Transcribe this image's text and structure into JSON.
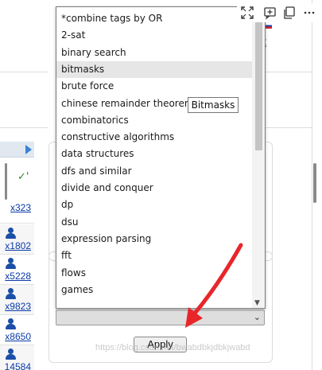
{
  "background": {
    "right_link": "t",
    "left_handles": [
      "x323",
      "x1802",
      "x5228",
      "x9823",
      "x8650",
      "14584"
    ]
  },
  "dropdown": {
    "items": [
      {
        "label": "*combine tags by OR",
        "highlighted": false
      },
      {
        "label": "2-sat",
        "highlighted": false
      },
      {
        "label": "binary search",
        "highlighted": false
      },
      {
        "label": "bitmasks",
        "highlighted": true
      },
      {
        "label": "brute force",
        "highlighted": false
      },
      {
        "label": "chinese remainder theorem",
        "highlighted": false
      },
      {
        "label": "combinatorics",
        "highlighted": false
      },
      {
        "label": "constructive algorithms",
        "highlighted": false
      },
      {
        "label": "data structures",
        "highlighted": false
      },
      {
        "label": "dfs and similar",
        "highlighted": false
      },
      {
        "label": "divide and conquer",
        "highlighted": false
      },
      {
        "label": "dp",
        "highlighted": false
      },
      {
        "label": "dsu",
        "highlighted": false
      },
      {
        "label": "expression parsing",
        "highlighted": false
      },
      {
        "label": "fft",
        "highlighted": false
      },
      {
        "label": "flows",
        "highlighted": false
      },
      {
        "label": "games",
        "highlighted": false
      }
    ],
    "highlight_color": "#e6e6e6"
  },
  "tooltip": {
    "text": "Bitmasks"
  },
  "select": {
    "selected_value": ""
  },
  "apply_button": {
    "label": "Apply"
  },
  "watermark": {
    "text": "https://blog.csdn.net/bwabdbkjdbkjwabd"
  },
  "colors": {
    "link": "#0a3aa8",
    "arrow": "#e8262a",
    "user_icon": "#1b4fa8"
  },
  "toolbar": {
    "icons": [
      "fullscreen-icon",
      "add-comment-icon",
      "copy-icon",
      "more-icon"
    ]
  }
}
